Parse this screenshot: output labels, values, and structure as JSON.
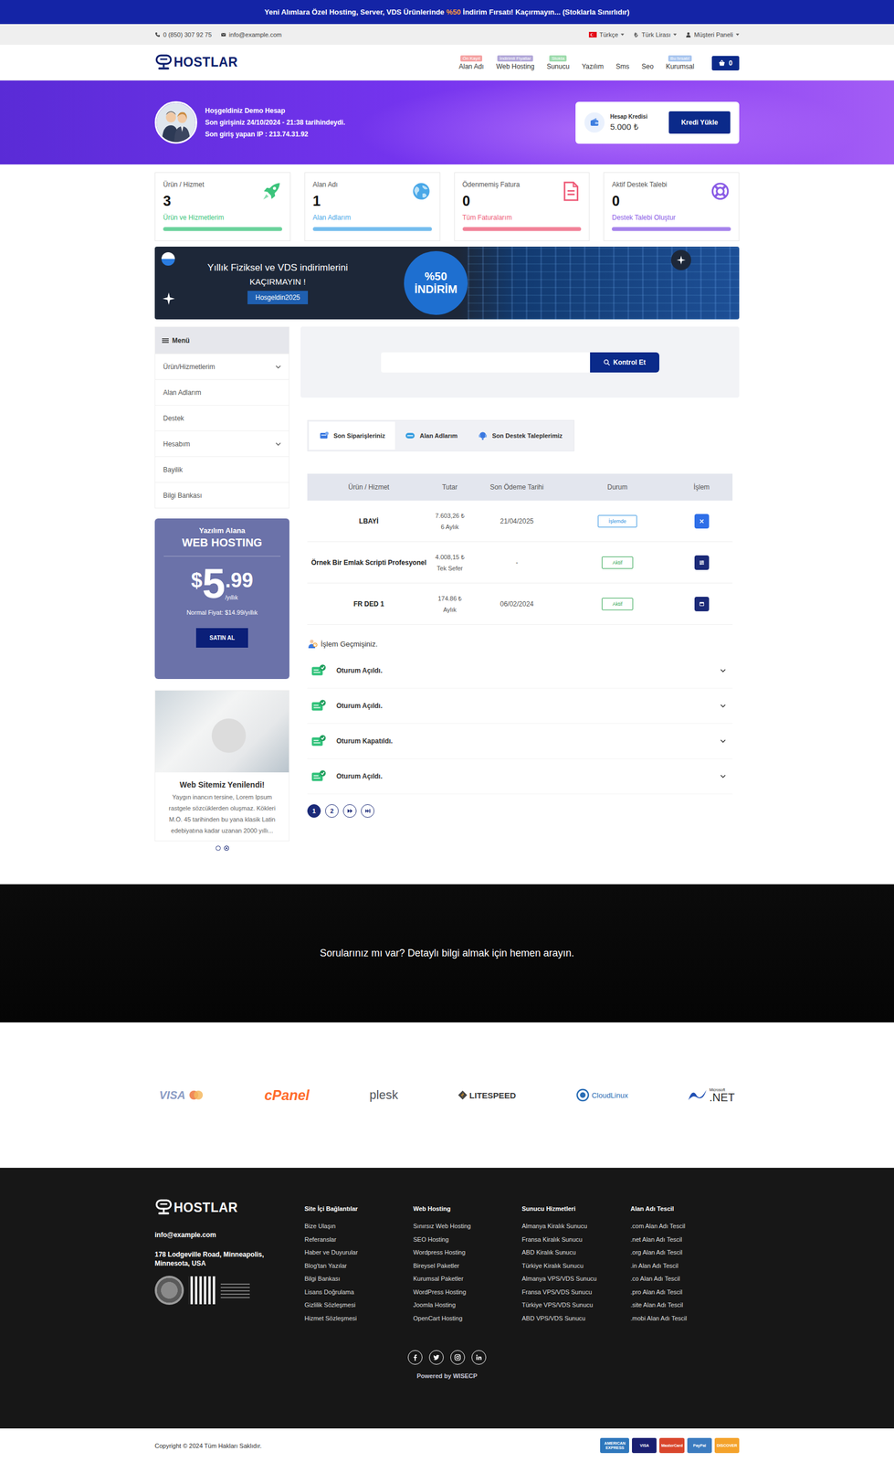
{
  "announcement": {
    "before": "Yeni Alımlara Özel Hosting, Server, VDS Ürünlerinde ",
    "highlight": "%50",
    "after": " İndirim Fırsatı! Kaçırmayın... (Stoklarla Sınırlıdır)"
  },
  "topbar": {
    "phone": "0 (850) 307 92 75",
    "email": "info@example.com",
    "language": "Türkçe",
    "currency": "Türk Lirası",
    "panel": "Müşteri Paneli"
  },
  "logo": "HOSTLAR",
  "nav": [
    {
      "label": "Alan Adı",
      "badge": "Ön Kayıt",
      "color": "#f5a3a3"
    },
    {
      "label": "Web Hosting",
      "badge": "İndirimli Fiyatlar",
      "color": "#b3a9d9"
    },
    {
      "label": "Sunucu",
      "badge": "Stokta",
      "color": "#9fdcae"
    },
    {
      "label": "Yazılım"
    },
    {
      "label": "Sms"
    },
    {
      "label": "Seo"
    },
    {
      "label": "Kurumsal",
      "badge": "Bu fırsatı!",
      "color": "#a9c6ef"
    }
  ],
  "cart": "0",
  "hero": {
    "welcome": "Hoşgeldiniz Demo Hesap",
    "last_login": "Son girişiniz 24/10/2024 - 21:38 tarihindeydi.",
    "last_ip": "Son giriş yapan IP : 213.74.31.92",
    "credit_label": "Hesap Kredisi",
    "credit": "5.000 ₺",
    "button": "Kredi Yükle"
  },
  "stats": [
    {
      "title": "Ürün / Hizmet",
      "count": "3",
      "link": "Ürün ve Hizmetlerim",
      "color": "#3cc47c",
      "kind": "rocket"
    },
    {
      "title": "Alan Adı",
      "count": "1",
      "link": "Alan Adlarım",
      "color": "#4aa8e8",
      "kind": "globe"
    },
    {
      "title": "Ödenmemiş Fatura",
      "count": "0",
      "link": "Tüm Faturalarım",
      "color": "#ee5b78",
      "kind": "invoice"
    },
    {
      "title": "Aktif Destek Talebi",
      "count": "0",
      "link": "Destek Talebi Oluştur",
      "color": "#8a5ce6",
      "kind": "support"
    }
  ],
  "banner": {
    "line1": "Yıllık Fiziksel ve VDS indirimlerini",
    "line2": "KAÇIRMAYIN !",
    "code": "Hosgeldin2025",
    "badge_top": "%50",
    "badge_bottom": "İNDİRİM"
  },
  "sidebar": {
    "title": "Menü",
    "items": [
      {
        "label": "Ürün/Hizmetlerim",
        "expandable": true
      },
      {
        "label": "Alan Adlarım",
        "expandable": false
      },
      {
        "label": "Destek",
        "expandable": false
      },
      {
        "label": "Hesabım",
        "expandable": true
      },
      {
        "label": "Bayilik",
        "expandable": false
      },
      {
        "label": "Bilgi Bankası",
        "expandable": false
      }
    ]
  },
  "promo": {
    "top": "Yazılım Alana",
    "title": "WEB HOSTING",
    "currency": "$",
    "price": "5",
    "cents": ".99",
    "period": "/yıllık",
    "normal": "Normal Fiyat: $14.99/yıllık",
    "button": "SATIN AL"
  },
  "blog": {
    "title": "Web Sitemiz Yenilendi!",
    "text": "Yaygın inancın tersine, Lorem Ipsum rastgele sözcüklerden oluşmaz. Kökleri M.Ö. 45 tarihinden bu yana klasik Latin edebiyatına kadar uzanan 2000 yıllı...",
    "dots": [
      {
        "selected": false
      },
      {
        "selected": true
      }
    ]
  },
  "search": {
    "button": "Kontrol Et"
  },
  "tabs": [
    {
      "label": "Son Siparişleriniz",
      "selected": true
    },
    {
      "label": "Alan Adlarım",
      "selected": false
    },
    {
      "label": "Son Destek Taleplerimiz",
      "selected": false
    }
  ],
  "table": {
    "columns": [
      "Ürün / Hizmet",
      "Tutar",
      "Son Ödeme Tarihi",
      "Durum",
      "İşlem"
    ],
    "rows": [
      {
        "product": "LBAYİ",
        "amount": "7.603,26 ₺",
        "period": "6 Aylık",
        "due": "21/04/2025",
        "status": "İşlemde",
        "status_color": "#2b8fe0",
        "action_color": "#2f6fe8",
        "kind": "cancel"
      },
      {
        "product": "Örnek Bir Emlak Scripti Profesyonel",
        "amount": "4.008,15 ₺",
        "period": "Tek Sefer",
        "due": "-",
        "status": "Aktif",
        "status_color": "#2ea44f",
        "action_color": "#1b2a78",
        "kind": "list"
      },
      {
        "product": "FR DED 1",
        "amount": "174.86 ₺",
        "period": "Aylık",
        "due": "06/02/2024",
        "status": "Aktif",
        "status_color": "#2ea44f",
        "action_color": "#1b2a78",
        "kind": "panel"
      }
    ]
  },
  "history": {
    "title": "İşlem Geçmişiniz.",
    "items": [
      "Oturum Açıldı.",
      "Oturum Açıldı.",
      "Oturum Kapatıldı.",
      "Oturum Açıldı."
    ],
    "pages": [
      {
        "label": "1",
        "selected": true
      },
      {
        "label": "2",
        "selected": false
      }
    ]
  },
  "cta": "Sorularınız mı var? Detaylı bilgi almak için hemen arayın.",
  "partners": [
    {
      "name": "VISA",
      "color": "#8a9bc4",
      "kind": "visa"
    },
    {
      "name": "cPanel",
      "color": "#ff6c2c",
      "kind": "cpanel"
    },
    {
      "name": "plesk",
      "color": "#52565b",
      "kind": "plesk"
    },
    {
      "name": "LITESPEED",
      "color": "#3a3a3a",
      "kind": "litespeed"
    },
    {
      "name": "CloudLinux",
      "color": "#2a6db5",
      "kind": "cloudlinux"
    },
    {
      "name": ".NET",
      "sub": "Microsoft",
      "color": "#2a2a2a",
      "kind": "dotnet"
    }
  ],
  "footer": {
    "email": "info@example.com",
    "address": "178 Lodgeville Road, Minneapolis, Minnesota, USA",
    "columns": [
      {
        "title": "Site İçi Bağlantılar",
        "links": [
          "Bize Ulaşın",
          "Referanslar",
          "Haber ve Duyurular",
          "Blog'tan Yazılar",
          "Bilgi Bankası",
          "Lisans Doğrulama",
          "Gizlilik Sözleşmesi",
          "Hizmet Sözleşmesi"
        ]
      },
      {
        "title": "Web Hosting",
        "links": [
          "Sınırsız Web Hosting",
          "SEO Hosting",
          "Wordpress Hosting",
          "Bireysel Paketler",
          "Kurumsal Paketler",
          "WordPress Hosting",
          "Joomla Hosting",
          "OpenCart Hosting"
        ]
      },
      {
        "title": "Sunucu Hizmetleri",
        "links": [
          "Almanya Kiralık Sunucu",
          "Fransa Kiralık Sunucu",
          "ABD Kiralık Sunucu",
          "Türkiye Kiralık Sunucu",
          "Almanya VPS/VDS Sunucu",
          "Fransa VPS/VDS Sunucu",
          "Türkiye VPS/VDS Sunucu",
          "ABD VPS/VDS Sunucu"
        ]
      },
      {
        "title": "Alan Adı Tescil",
        "links": [
          ".com Alan Adı Tescil",
          ".net Alan Adı Tescil",
          ".org Alan Adı Tescil",
          ".in Alan Adı Tescil",
          ".co Alan Adı Tescil",
          ".pro Alan Adı Tescil",
          ".site Alan Adı Tescil",
          ".mobi Alan Adı Tescil"
        ]
      }
    ],
    "powered": "Powered by WISECP"
  },
  "copyright": "Copyright © 2024 Tüm Hakları Saklıdır.",
  "payments": [
    {
      "label": "AMERICAN EXPRESS",
      "color": "#2e77bc"
    },
    {
      "label": "VISA",
      "color": "#1a1f71"
    },
    {
      "label": "MasterCard",
      "color": "#d9452b"
    },
    {
      "label": "PayPal",
      "color": "#3b7bbf"
    },
    {
      "label": "DISCOVER",
      "color": "#f4a22a"
    }
  ]
}
